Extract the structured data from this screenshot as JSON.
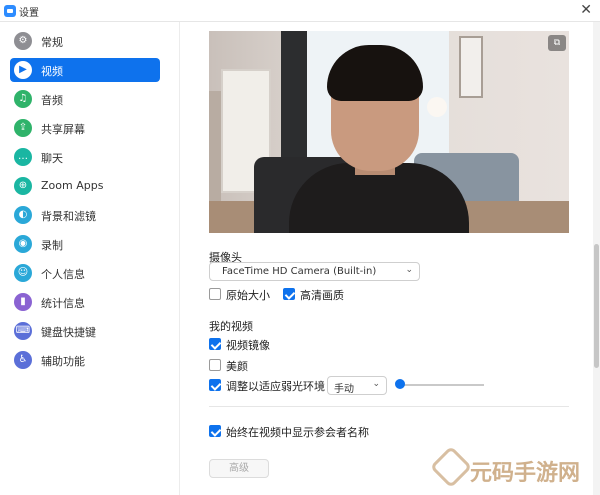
{
  "window": {
    "title": "设置",
    "close_glyph": "✕"
  },
  "sidebar": {
    "items": [
      {
        "label": "常规",
        "icon": "gear-icon",
        "color": "#8e8e93",
        "glyph": "⚙",
        "active": false
      },
      {
        "label": "视频",
        "icon": "video-icon",
        "color": "#0E72ED",
        "glyph": "▶",
        "active": true
      },
      {
        "label": "音频",
        "icon": "headphones-icon",
        "color": "#2fb36a",
        "glyph": "♫",
        "active": false
      },
      {
        "label": "共享屏幕",
        "icon": "share-screen-icon",
        "color": "#2fb36a",
        "glyph": "⇪",
        "active": false
      },
      {
        "label": "聊天",
        "icon": "chat-icon",
        "color": "#1ab6a2",
        "glyph": "…",
        "active": false
      },
      {
        "label": "Zoom Apps",
        "icon": "apps-icon",
        "color": "#1ab6a2",
        "glyph": "⊕",
        "active": false
      },
      {
        "label": "背景和滤镜",
        "icon": "background-icon",
        "color": "#2aa8d8",
        "glyph": "◐",
        "active": false
      },
      {
        "label": "录制",
        "icon": "record-icon",
        "color": "#2aa8d8",
        "glyph": "◉",
        "active": false
      },
      {
        "label": "个人信息",
        "icon": "profile-icon",
        "color": "#2aa8d8",
        "glyph": "☺",
        "active": false
      },
      {
        "label": "统计信息",
        "icon": "statistics-icon",
        "color": "#8a63d2",
        "glyph": "▮",
        "active": false
      },
      {
        "label": "键盘快捷键",
        "icon": "keyboard-icon",
        "color": "#5b6fd8",
        "glyph": "⌨",
        "active": false
      },
      {
        "label": "辅助功能",
        "icon": "accessibility-icon",
        "color": "#5b6fd8",
        "glyph": "♿",
        "active": false
      }
    ]
  },
  "video": {
    "pip_glyph": "⧉",
    "camera_heading": "摄像头",
    "camera_value": "FaceTime HD Camera (Built-in)",
    "original_size": {
      "label": "原始大小",
      "checked": false
    },
    "hd": {
      "label": "高清画质",
      "checked": true
    },
    "my_video_heading": "我的视频",
    "mirror": {
      "label": "视频镜像",
      "checked": true
    },
    "beauty": {
      "label": "美颜",
      "checked": false
    },
    "low_light": {
      "label": "调整以适应弱光环境",
      "checked": true,
      "mode": "手动",
      "level": 0.0
    },
    "show_names": {
      "label": "始终在视频中显示参会者名称",
      "checked": true
    },
    "advanced_label": "高级"
  },
  "watermark": {
    "text": "元码手游网"
  },
  "colors": {
    "accent": "#0E72ED"
  }
}
